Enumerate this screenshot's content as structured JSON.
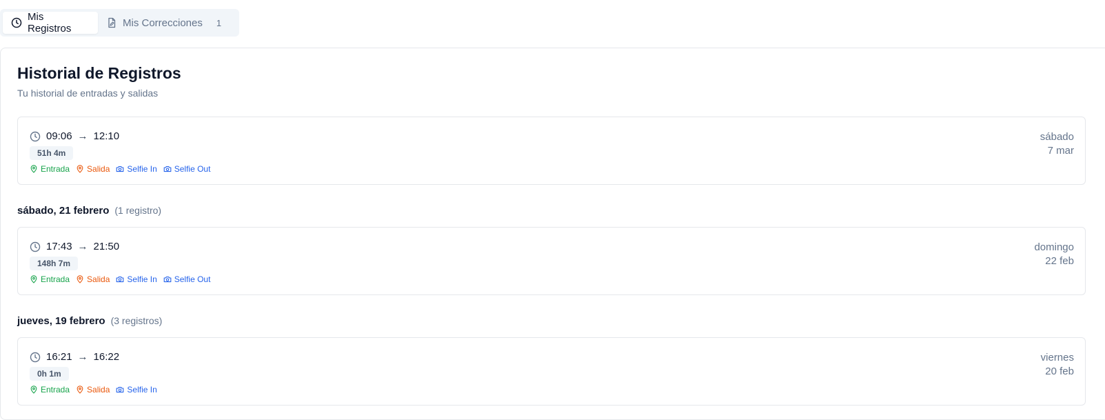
{
  "tabs": [
    {
      "label": "Mis Registros",
      "icon": "clock-icon",
      "active": true
    },
    {
      "label": "Mis Correcciones",
      "icon": "file-edit-icon",
      "count": "1",
      "active": false
    }
  ],
  "header": {
    "title": "Historial de Registros",
    "subtitle": "Tu historial de entradas y salidas"
  },
  "entries": [
    {
      "start": "09:06",
      "end": "12:10",
      "arrow": "→",
      "duration": "51h 4m",
      "day": "sábado",
      "date": "7 mar",
      "links": [
        "Entrada",
        "Salida",
        "Selfie In",
        "Selfie Out"
      ]
    },
    {
      "start": "17:43",
      "end": "21:50",
      "arrow": "→",
      "duration": "148h 7m",
      "day": "domingo",
      "date": "22 feb",
      "links": [
        "Entrada",
        "Salida",
        "Selfie In",
        "Selfie Out"
      ]
    },
    {
      "start": "16:21",
      "end": "16:22",
      "arrow": "→",
      "duration": "0h 1m",
      "day": "viernes",
      "date": "20 feb",
      "links": [
        "Entrada",
        "Salida",
        "Selfie In"
      ]
    }
  ],
  "groups": [
    {
      "title": "sábado, 21 febrero",
      "count": "(1 registro)"
    },
    {
      "title": "jueves, 19 febrero",
      "count": "(3 registros)"
    }
  ],
  "colors": {
    "entrada": "#16a34a",
    "salida": "#ea580c",
    "selfie": "#2563eb"
  }
}
